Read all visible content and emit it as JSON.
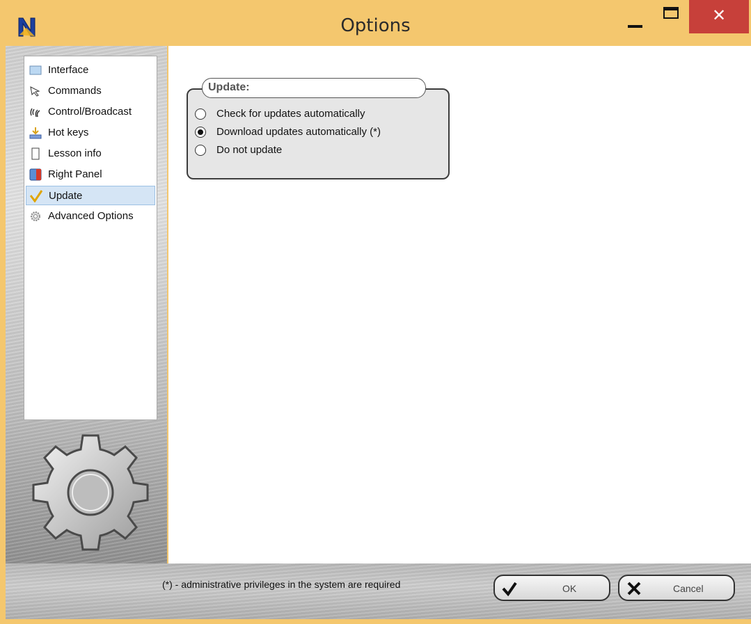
{
  "window": {
    "title": "Options",
    "close_glyph": "✕"
  },
  "sidebar": {
    "items": [
      {
        "label": "Interface",
        "icon": "interface-icon"
      },
      {
        "label": "Commands",
        "icon": "cursor-icon"
      },
      {
        "label": "Control/Broadcast",
        "icon": "broadcast-icon"
      },
      {
        "label": "Hot keys",
        "icon": "hotkeys-icon"
      },
      {
        "label": "Lesson info",
        "icon": "document-icon"
      },
      {
        "label": "Right Panel",
        "icon": "right-panel-icon"
      },
      {
        "label": "Update",
        "icon": "checkmark-icon",
        "selected": true
      },
      {
        "label": "Advanced Options",
        "icon": "gear-icon"
      }
    ]
  },
  "update_group": {
    "title": "Update:",
    "options": [
      {
        "label": "Check for updates automatically",
        "checked": false
      },
      {
        "label": "Download updates automatically (*)",
        "checked": true
      },
      {
        "label": "Do not update",
        "checked": false
      }
    ]
  },
  "footer": {
    "note": "(*) - administrative privileges in the system are required",
    "ok_label": "OK",
    "cancel_label": "Cancel"
  },
  "colors": {
    "title_bar": "#f4c76e",
    "close_button": "#c7403a",
    "selected_item": "#d5e5f5"
  }
}
